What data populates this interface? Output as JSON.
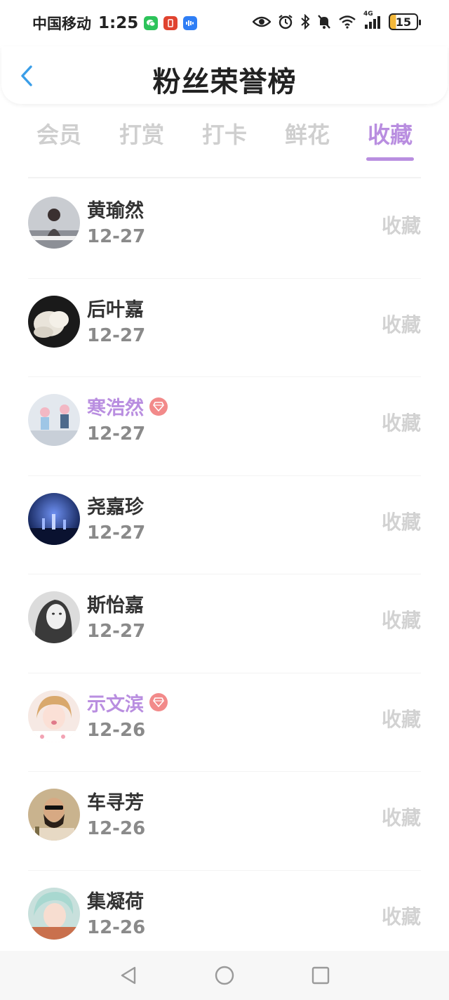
{
  "status_bar": {
    "carrier": "中国移动",
    "time": "1:25",
    "network": "4G",
    "battery": "15"
  },
  "header": {
    "title": "粉丝荣誉榜"
  },
  "tabs": [
    {
      "label": "会员",
      "active": false
    },
    {
      "label": "打赏",
      "active": false
    },
    {
      "label": "打卡",
      "active": false
    },
    {
      "label": "鲜花",
      "active": false
    },
    {
      "label": "收藏",
      "active": true
    }
  ],
  "fans": [
    {
      "name": "黄瑜然",
      "date": "12-27",
      "action": "收藏",
      "vip": false
    },
    {
      "name": "后叶嘉",
      "date": "12-27",
      "action": "收藏",
      "vip": false
    },
    {
      "name": "寒浩然",
      "date": "12-27",
      "action": "收藏",
      "vip": true
    },
    {
      "name": "尧嘉珍",
      "date": "12-27",
      "action": "收藏",
      "vip": false
    },
    {
      "name": "斯怡嘉",
      "date": "12-27",
      "action": "收藏",
      "vip": false
    },
    {
      "name": "示文滨",
      "date": "12-26",
      "action": "收藏",
      "vip": true
    },
    {
      "name": "车寻芳",
      "date": "12-26",
      "action": "收藏",
      "vip": false
    },
    {
      "name": "集凝荷",
      "date": "12-26",
      "action": "收藏",
      "vip": false
    }
  ],
  "colors": {
    "accent": "#b98ee0",
    "vip_badge": "#f28a8a",
    "back_arrow": "#3a9ee8"
  }
}
